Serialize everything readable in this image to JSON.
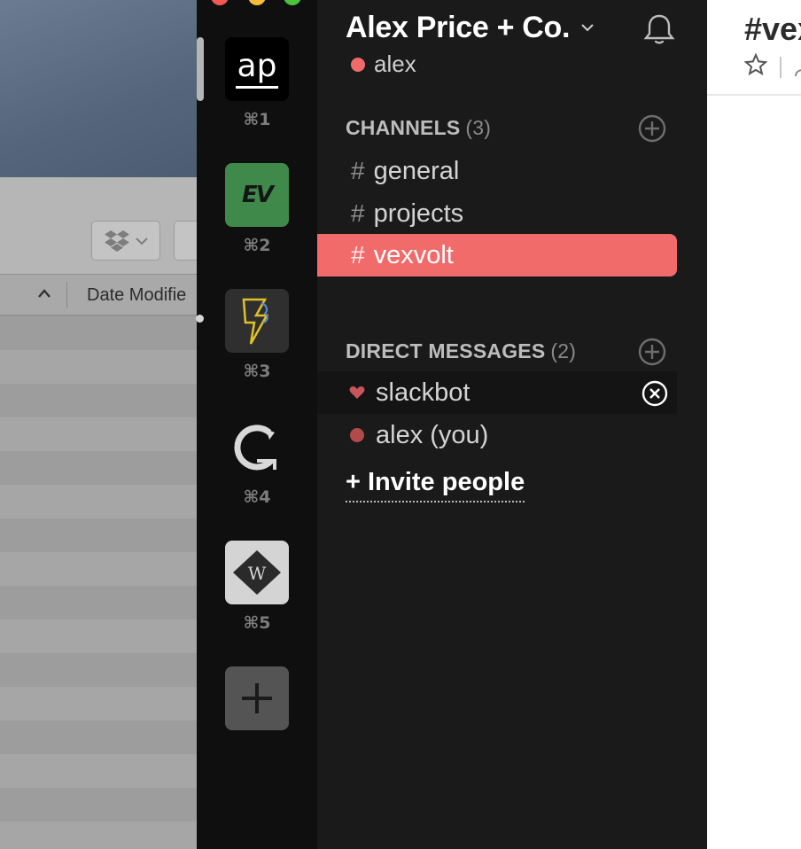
{
  "background_window": {
    "column_header": "Date Modifie"
  },
  "team_rail": {
    "teams": [
      {
        "initials": "ap",
        "shortcut": "⌘1",
        "color": "#000000"
      },
      {
        "initials": "EV",
        "shortcut": "⌘2",
        "color": "#3f8a4a"
      },
      {
        "initials": "",
        "shortcut": "⌘3",
        "color": "#2f2f2f"
      },
      {
        "initials": "",
        "shortcut": "⌘4",
        "color": "#0f0f0f"
      },
      {
        "initials": "",
        "shortcut": "⌘5",
        "color": "#d4d4d4"
      }
    ]
  },
  "sidebar": {
    "team_name": "Alex Price + Co.",
    "user": {
      "name": "alex",
      "status_color": "#f06a6a"
    },
    "channels_section": {
      "label": "CHANNELS",
      "count": "(3)"
    },
    "channels": [
      {
        "name": "general",
        "active": false
      },
      {
        "name": "projects",
        "active": false
      },
      {
        "name": "vexvolt",
        "active": true
      }
    ],
    "dm_section": {
      "label": "DIRECT MESSAGES",
      "count": "(2)"
    },
    "direct_messages": [
      {
        "name": "slackbot",
        "icon": "heart-icon",
        "color": "#c9545b"
      },
      {
        "name": "alex (you)",
        "icon": "presence-dot-icon",
        "color": "#b24a4a"
      }
    ],
    "invite_label": "Invite people",
    "invite_plus": "+"
  },
  "channel_header": {
    "title": "#vexvolt"
  },
  "colors": {
    "accent": "#f26b6b",
    "sidebar_bg": "#1a1a1a",
    "rail_bg": "#0f0f0f"
  }
}
